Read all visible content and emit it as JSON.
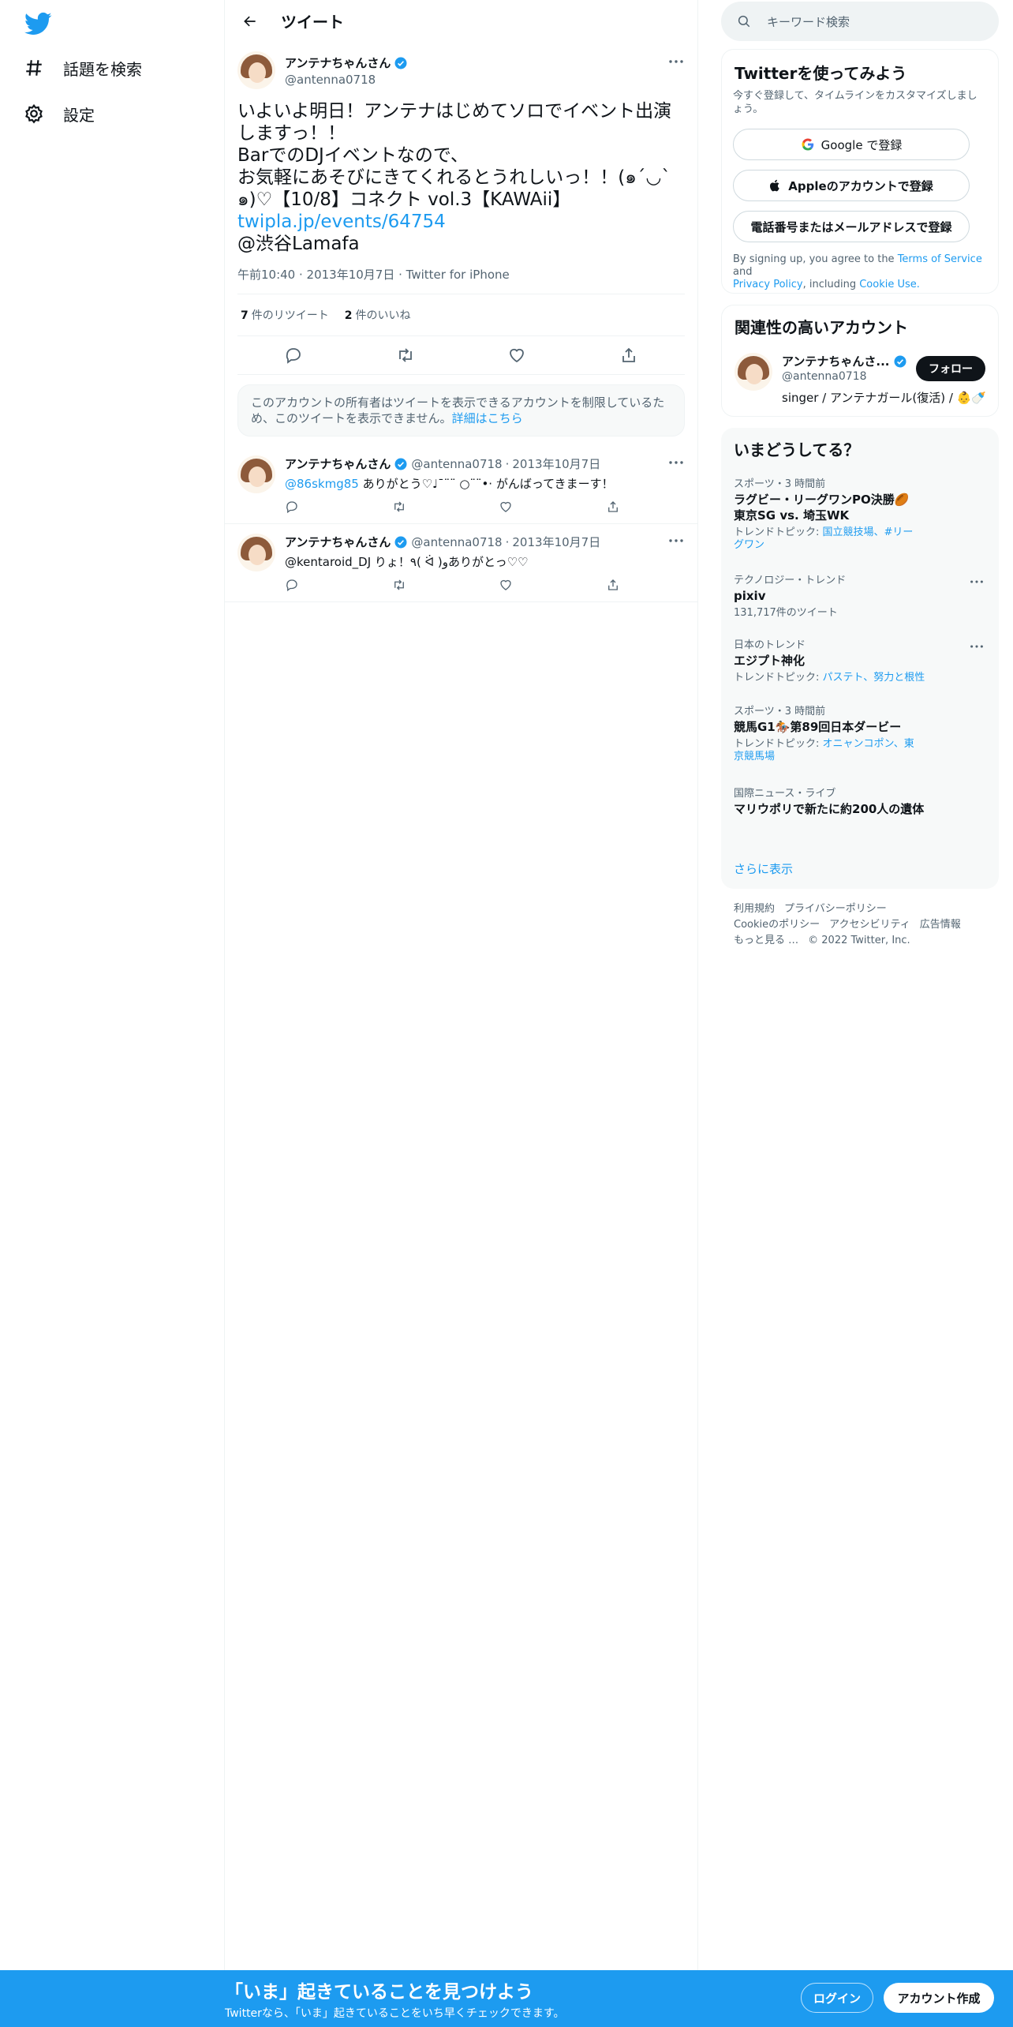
{
  "colors": {
    "accent": "#1d9bf0",
    "text": "#0f1419",
    "muted": "#536471",
    "border": "#eff3f4"
  },
  "sidebar": {
    "logo": "twitter-logo-icon",
    "items": [
      {
        "label": "話題を検索",
        "icon": "hashtag-icon"
      },
      {
        "label": "設定",
        "icon": "gear-icon"
      }
    ]
  },
  "header": {
    "title": "ツイート"
  },
  "tweet": {
    "name": "アンテナちゃんさん",
    "handle": "@antenna0718",
    "text": "いよいよ明日！アンテナはじめてソロでイベント出演しますっ！！\nBarでのDJイベントなので、\nお気軽にあそびにきてくれるとうれしいっ！！(๑´◡`๑)♡【10/8】コネクト vol.3【KAWAii】",
    "link": "twipla.jp/events/64754",
    "location": "@渋谷Lamafa",
    "time": "午前10:40",
    "date": "2013年10月7日",
    "client": "Twitter for iPhone",
    "retweets": "7",
    "retweets_label": "件のリツイート",
    "likes": "2",
    "likes_label": "件のいいね"
  },
  "notice": {
    "text": "このアカウントの所有者はツイートを表示できるアカウントを制限しているため、このツイートを表示できません。",
    "link": "詳細はこちら"
  },
  "replies": [
    {
      "name": "アンテナちゃんさん",
      "handle": "@antenna0718",
      "date": "2013年10月7日",
      "mention": "@86skmg85",
      "text": " ありがとう♡♩¯¨¨ ○¨¨•· がんばってきまーす！"
    },
    {
      "name": "アンテナちゃんさん",
      "handle": "@antenna0718",
      "date": "2013年10月7日",
      "mention": "",
      "text": "@kentaroid_DJ りょ！٩( ᐛ )وありがとっ♡♡"
    }
  ],
  "search": {
    "placeholder": "キーワード検索"
  },
  "signup_card": {
    "title": "Twitterを使ってみよう",
    "subtitle": "今すぐ登録して、タイムラインをカスタマイズしましょう。",
    "google": "Google で登録",
    "apple": "Appleのアカウントで登録",
    "phone": "電話番号またはメールアドレスで登録",
    "legal_1": "By signing up, you agree to the ",
    "terms": "Terms of Service",
    "legal_2": " and",
    "privacy": "Privacy Policy",
    "legal_3": ", including ",
    "cookie": "Cookie Use."
  },
  "related": {
    "title": "関連性の高いアカウント",
    "name": "アンテナちゃんさ...",
    "handle": "@antenna0718",
    "bio": "singer / アンテナガール(復活) / 👶🍼",
    "follow": "フォロー"
  },
  "trends": {
    "title": "いまどうしてる？",
    "items": [
      {
        "cat": "スポーツ・3 時間前",
        "title": "ラグビー・リーグワンPO決勝🏉\n東京SG vs. 埼玉WK",
        "sub": "トレンドトピック: ",
        "links": "国立競技場、#リーグワン"
      },
      {
        "cat": "テクノロジー・トレンド",
        "title": "pixiv",
        "sub": "131,717件のツイート",
        "links": ""
      },
      {
        "cat": "日本のトレンド",
        "title": "エジプト神化",
        "sub": "トレンドトピック: ",
        "links": "パステト、努力と根性"
      },
      {
        "cat": "スポーツ・3 時間前",
        "title": "競馬G1🏇第89回日本ダービー",
        "sub": "トレンドトピック: ",
        "links": "オニャンコポン、東京競馬場"
      },
      {
        "cat": "国際ニュース・ライブ",
        "title": "マリウポリで新たに約200人の遺体",
        "sub": "",
        "links": ""
      }
    ],
    "more": "さらに表示"
  },
  "footer": {
    "links": [
      "利用規約",
      "プライバシーポリシー",
      "Cookieのポリシー",
      "アクセシビリティ",
      "広告情報",
      "もっと見る …"
    ],
    "copyright": "© 2022 Twitter, Inc."
  },
  "bottom_bar": {
    "headline": "「いま」起きていることを見つけよう",
    "sub": "Twitterなら、「いま」起きていることをいち早くチェックできます。",
    "login": "ログイン",
    "signup": "アカウント作成"
  }
}
